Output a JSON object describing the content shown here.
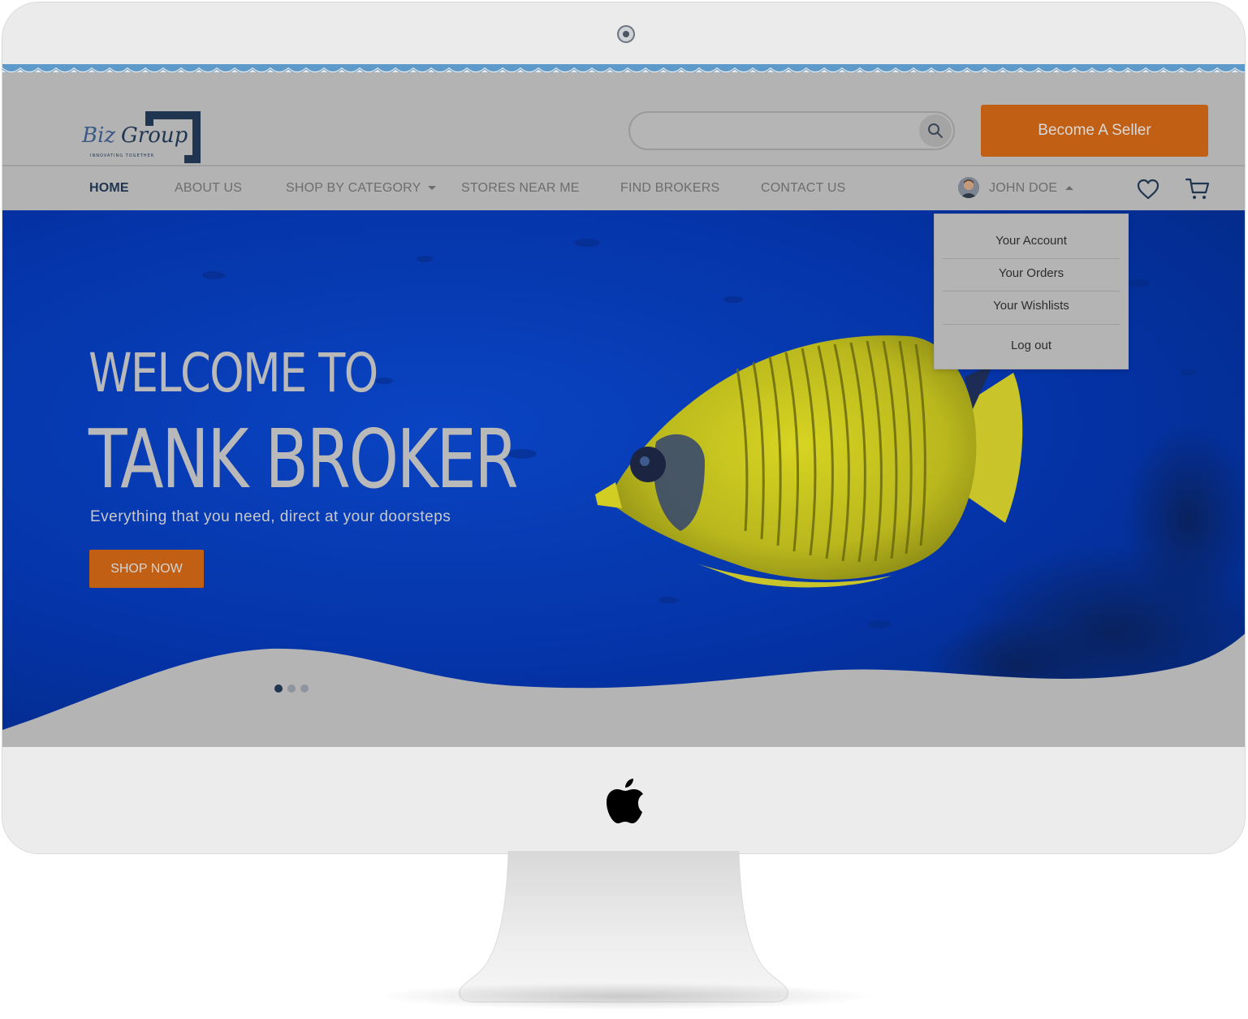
{
  "header": {
    "logo_text": "Biz Group",
    "logo_tagline": "INNOVATING TOGETHER",
    "search_placeholder": "",
    "search_icon": "search-icon",
    "seller_button": "Become A Seller"
  },
  "nav": {
    "items": [
      {
        "label": "HOME",
        "active": true
      },
      {
        "label": "ABOUT US",
        "active": false
      },
      {
        "label": "SHOP BY CATEGORY",
        "active": false
      },
      {
        "label": "STORES NEAR ME",
        "active": false
      },
      {
        "label": "FIND BROKERS",
        "active": false
      },
      {
        "label": "CONTACT US",
        "active": false
      }
    ],
    "user_name": "JOHN DOE",
    "wishlist_icon": "heart-icon",
    "cart_icon": "cart-icon"
  },
  "user_menu": {
    "items": [
      "Your Account",
      "Your Orders",
      "Your Wishlists",
      "Log out"
    ]
  },
  "hero": {
    "title_line1": "WELCOME TO",
    "title_line2": "TANK BROKER",
    "subtitle": "Everything that you need, direct at your doorsteps",
    "cta": "SHOP NOW",
    "slides_total": 3,
    "active_slide": 1
  },
  "colors": {
    "accent": "#c15f14",
    "nav_active": "#1f3550",
    "hero_blue": "#0433a6",
    "overlay_gray": "#b3b3b3"
  }
}
